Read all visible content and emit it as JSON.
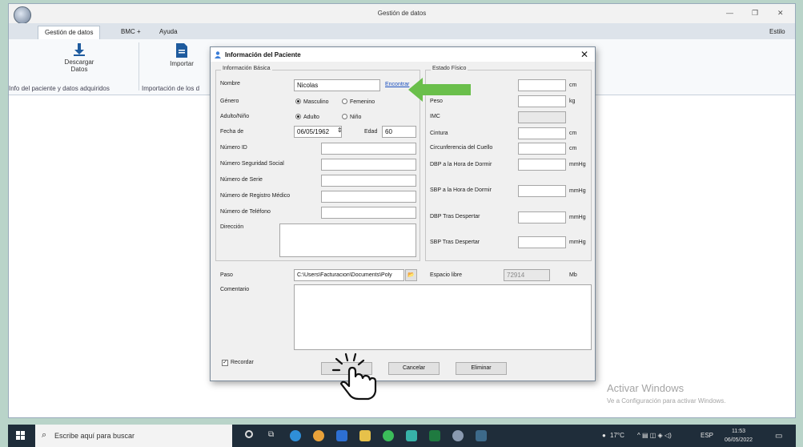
{
  "window": {
    "title": "Gestión de datos",
    "style_label": "Estilo"
  },
  "ribbon_tabs": [
    "Gestión de datos",
    "BMC +",
    "Ayuda"
  ],
  "ribbon": {
    "download_label_1": "Descargar",
    "download_label_2": "Datos",
    "import_label": "Importar",
    "group1": "Info del paciente y datos adquiridos",
    "group2": "Importación de los d"
  },
  "dialog": {
    "title": "Información del Paciente",
    "basic": {
      "legend": "Información Básica",
      "nombre_label": "Nombre",
      "nombre_value": "Nicolas",
      "encontrar_link": "Encontrar",
      "genero_label": "Género",
      "masculino": "Masculino",
      "femenino": "Femenino",
      "adulto_label": "Adulto/Niño",
      "adulto": "Adulto",
      "nino": "Niño",
      "fecha_label": "Fecha de",
      "fecha_value": "06/05/1962",
      "edad_label": "Edad",
      "edad_value": "60",
      "numero_id": "Número ID",
      "seguridad_social": "Número Seguridad Social",
      "serie": "Número de Serie",
      "registro_medico": "Número de Registro Médico",
      "telefono": "Número de Teléfono",
      "direccion": "Dirección"
    },
    "physical": {
      "legend": "Estado Físico",
      "peso_label": "Peso",
      "imc": "IMC",
      "cintura": "Cintura",
      "cuello": "Circunferencia del Cuello",
      "dbp_dormir": "DBP a la Hora de Dormir",
      "sbp_dormir": "SBP a la Hora de Dormir",
      "dbp_despertar": "DBP Tras Despertar",
      "sbp_despertar": "SBP Tras Despertar",
      "unit_cm": "cm",
      "unit_kg": "kg",
      "unit_mmhg": "mmHg"
    },
    "paso_label": "Paso",
    "paso_value": "C:\\Users\\Facturacion\\Documents\\Poly",
    "espacio_label": "Espacio libre",
    "espacio_value": "72914",
    "espacio_unit": "Mb",
    "comentario_label": "Comentario",
    "recordar_label": "Recordar",
    "cancel_button": "Cancelar",
    "delete_button": "Eliminar"
  },
  "watermark": {
    "title": "Activar Windows",
    "subtitle": "Ve a Configuración para activar Windows."
  },
  "taskbar": {
    "search_placeholder": "Escribe aquí para buscar",
    "weather": "17°C",
    "lang": "ESP",
    "time": "11:53",
    "date": "06/05/2022"
  },
  "colors": {
    "hint_arrow": "#6abf4b",
    "ribbon_accent": "#1e5b9e"
  }
}
